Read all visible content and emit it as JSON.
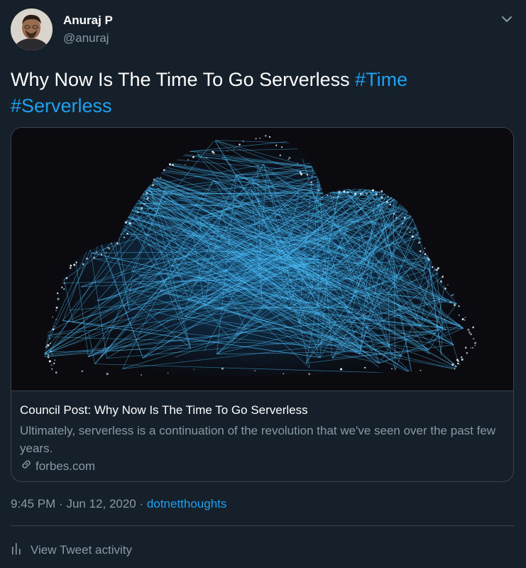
{
  "author": {
    "name": "Anuraj P",
    "handle": "@anuraj"
  },
  "tweet": {
    "text": "Why Now Is The Time To Go Serverless",
    "hashtags": [
      "#Time",
      "#Serverless"
    ]
  },
  "card": {
    "title": "Council Post: Why Now Is The Time To Go Serverless",
    "description": "Ultimately, serverless is a continuation of the revolution that we've seen over the past few years.",
    "domain": "forbes.com"
  },
  "meta": {
    "time": "9:45 PM",
    "separator": "·",
    "date": "Jun 12, 2020",
    "via": "dotnetthoughts"
  },
  "actions": {
    "activity_label": "View Tweet activity"
  },
  "icons": {
    "menu": "chevron-down-icon",
    "link": "link-icon",
    "activity": "bar-chart-icon"
  },
  "colors": {
    "background": "#15202b",
    "accent": "#1da1f2",
    "secondary_text": "#8899a6",
    "border": "#38444d"
  }
}
